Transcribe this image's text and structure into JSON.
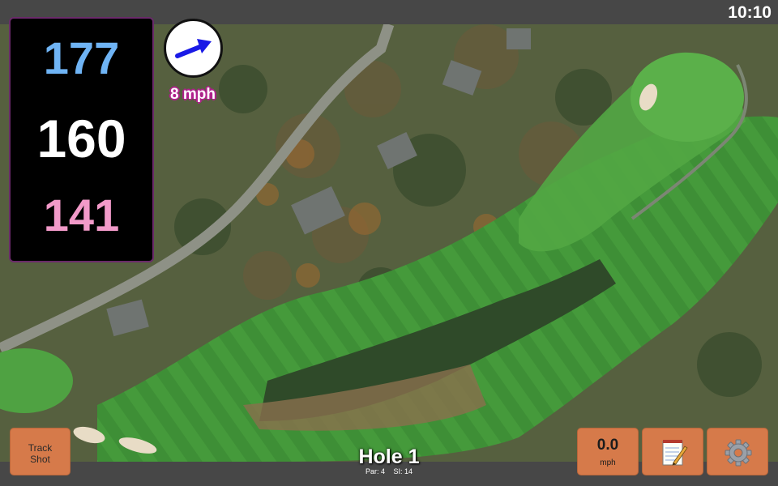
{
  "status": {
    "time": "10:10"
  },
  "distances": {
    "back": "177",
    "middle": "160",
    "front": "141"
  },
  "wind": {
    "speed": "8 mph",
    "direction_icon": "wind-arrow-icon"
  },
  "hole": {
    "title": "Hole 1",
    "par": "Par: 4",
    "si": "SI: 14"
  },
  "buttons": {
    "track_shot_line1": "Track",
    "track_shot_line2": "Shot",
    "speed_value": "0.0",
    "speed_unit": "mph",
    "notes_icon": "notepad-icon",
    "settings_icon": "gear-icon"
  },
  "colors": {
    "back_distance": "#6fb4f5",
    "middle_distance": "#ffffff",
    "front_distance": "#f29ac9",
    "button": "#d67a4a",
    "wind_arrow": "#1a1ae6"
  }
}
